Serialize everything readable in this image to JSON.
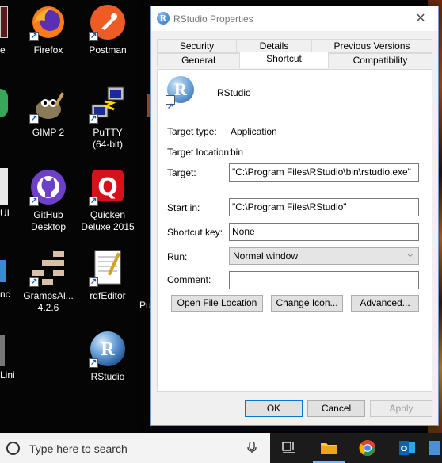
{
  "desktop": {
    "icons": [
      {
        "label": "Firefox",
        "icon": "firefox-icon"
      },
      {
        "label": "Postman",
        "icon": "postman-icon"
      },
      {
        "label": "GIMP 2",
        "icon": "gimp-icon"
      },
      {
        "label": "PuTTY",
        "label2": "(64-bit)",
        "icon": "putty-icon"
      },
      {
        "label": "GitHub",
        "label2": "Desktop",
        "icon": "github-icon"
      },
      {
        "label": "Quicken",
        "label2": "Deluxe 2015",
        "icon": "quicken-icon"
      },
      {
        "label": "GrampsAl...",
        "label2": "4.2.6",
        "icon": "gramps-icon"
      },
      {
        "label": "rdfEditor",
        "icon": "rdfeditor-icon"
      },
      {
        "label": "RStudio",
        "icon": "rstudio-icon"
      }
    ],
    "partial_labels": [
      "e",
      "UI",
      "nc",
      "Lini",
      "Pu"
    ]
  },
  "dialog": {
    "title": "RStudio Properties",
    "tabs_row1": [
      "Security",
      "Details",
      "Previous Versions"
    ],
    "tabs_row2": [
      "General",
      "Shortcut",
      "Compatibility"
    ],
    "active_tab": "Shortcut",
    "name": "RStudio",
    "target_type_label": "Target type:",
    "target_type_value": "Application",
    "target_location_label": "Target location:",
    "target_location_value": "bin",
    "target_label": "Target:",
    "target_value": "\"C:\\Program Files\\RStudio\\bin\\rstudio.exe\"",
    "start_in_label": "Start in:",
    "start_in_value": "\"C:\\Program Files\\RStudio\"",
    "shortcut_key_label": "Shortcut key:",
    "shortcut_key_value": "None",
    "run_label": "Run:",
    "run_value": "Normal window",
    "comment_label": "Comment:",
    "comment_value": "",
    "open_file_location": "Open File Location",
    "change_icon": "Change Icon...",
    "advanced": "Advanced...",
    "ok": "OK",
    "cancel": "Cancel",
    "apply": "Apply"
  },
  "taskbar": {
    "search_placeholder": "Type here to search"
  },
  "colors": {
    "accent": "#7eb4ea",
    "taskbar": "#1b1b1b",
    "dialog_bg": "#f0f0f0"
  }
}
